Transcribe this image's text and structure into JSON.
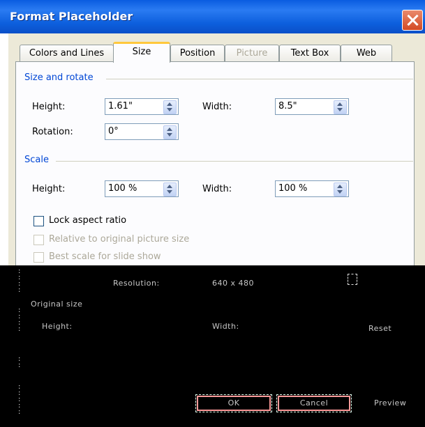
{
  "window": {
    "title": "Format Placeholder"
  },
  "tabs": [
    {
      "label": "Colors and Lines",
      "state": "normal"
    },
    {
      "label": "Size",
      "state": "active"
    },
    {
      "label": "Position",
      "state": "normal"
    },
    {
      "label": "Picture",
      "state": "disabled"
    },
    {
      "label": "Text Box",
      "state": "normal"
    },
    {
      "label": "Web",
      "state": "normal"
    }
  ],
  "size_rotate": {
    "title": "Size and rotate",
    "height_label": "Height:",
    "height_value": "1.61\"",
    "width_label": "Width:",
    "width_value": "8.5\"",
    "rotation_label": "Rotation:",
    "rotation_value": "0°"
  },
  "scale": {
    "title": "Scale",
    "height_label": "Height:",
    "height_value": "100 %",
    "width_label": "Width:",
    "width_value": "100 %",
    "lock_aspect_label": "Lock aspect ratio",
    "lock_aspect_checked": false,
    "relative_label": "Relative to original picture size",
    "best_scale_label": "Best scale for slide show"
  },
  "lower": {
    "resolution_label": "Resolution:",
    "resolution_value": "640 x 480",
    "original_size_title": "Original size",
    "orig_height_label": "Height:",
    "orig_width_label": "Width:",
    "reset_label": "Reset",
    "ok_label": "OK",
    "cancel_label": "Cancel",
    "preview_label": "Preview"
  },
  "colors": {
    "titlebar": "#0a5ce0",
    "section_title": "#0046d5",
    "dialog_bg": "#ece9d8",
    "active_tab_accent": "#ffc83c"
  }
}
